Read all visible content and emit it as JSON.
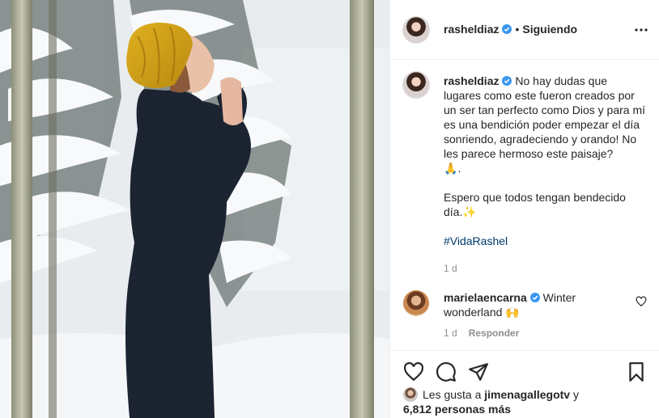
{
  "header": {
    "username": "rasheldiaz",
    "separator": "•",
    "follow_status": "Siguiendo",
    "icons": {
      "avatar": "profile-avatar",
      "verified": "verified-badge-icon",
      "more": "more-options-icon"
    }
  },
  "caption": {
    "username": "rasheldiaz",
    "line1": "No hay dudas que lugares como este fueron creados por un ser tan perfecto como Dios y para mí es una bendición poder empezar el día sonriendo, agradeciendo y orando! No les parece hermoso este paisaje?",
    "emoji1": "🙏",
    "emoji1_suffix": ".",
    "line2": "Espero que todos tengan bendecido día.",
    "emoji2": "✨",
    "hashtag": "#VidaRashel",
    "time": "1 d"
  },
  "comment": {
    "username": "marielaencarna",
    "text": "Winter wonderland",
    "emoji": "🙌",
    "time": "1 d",
    "reply_label": "Responder"
  },
  "actions": {
    "icons": [
      "heart-icon",
      "comment-icon",
      "share-icon",
      "bookmark-icon"
    ]
  },
  "likes": {
    "prefix": "Les gusta a",
    "liker": "jimenagallegotv",
    "conjunction": "y",
    "others": "6,812 personas más"
  },
  "colors": {
    "verified": "#3897f0",
    "hashtag": "#00376b",
    "muted": "#8e8e8e",
    "border": "#efefef"
  }
}
